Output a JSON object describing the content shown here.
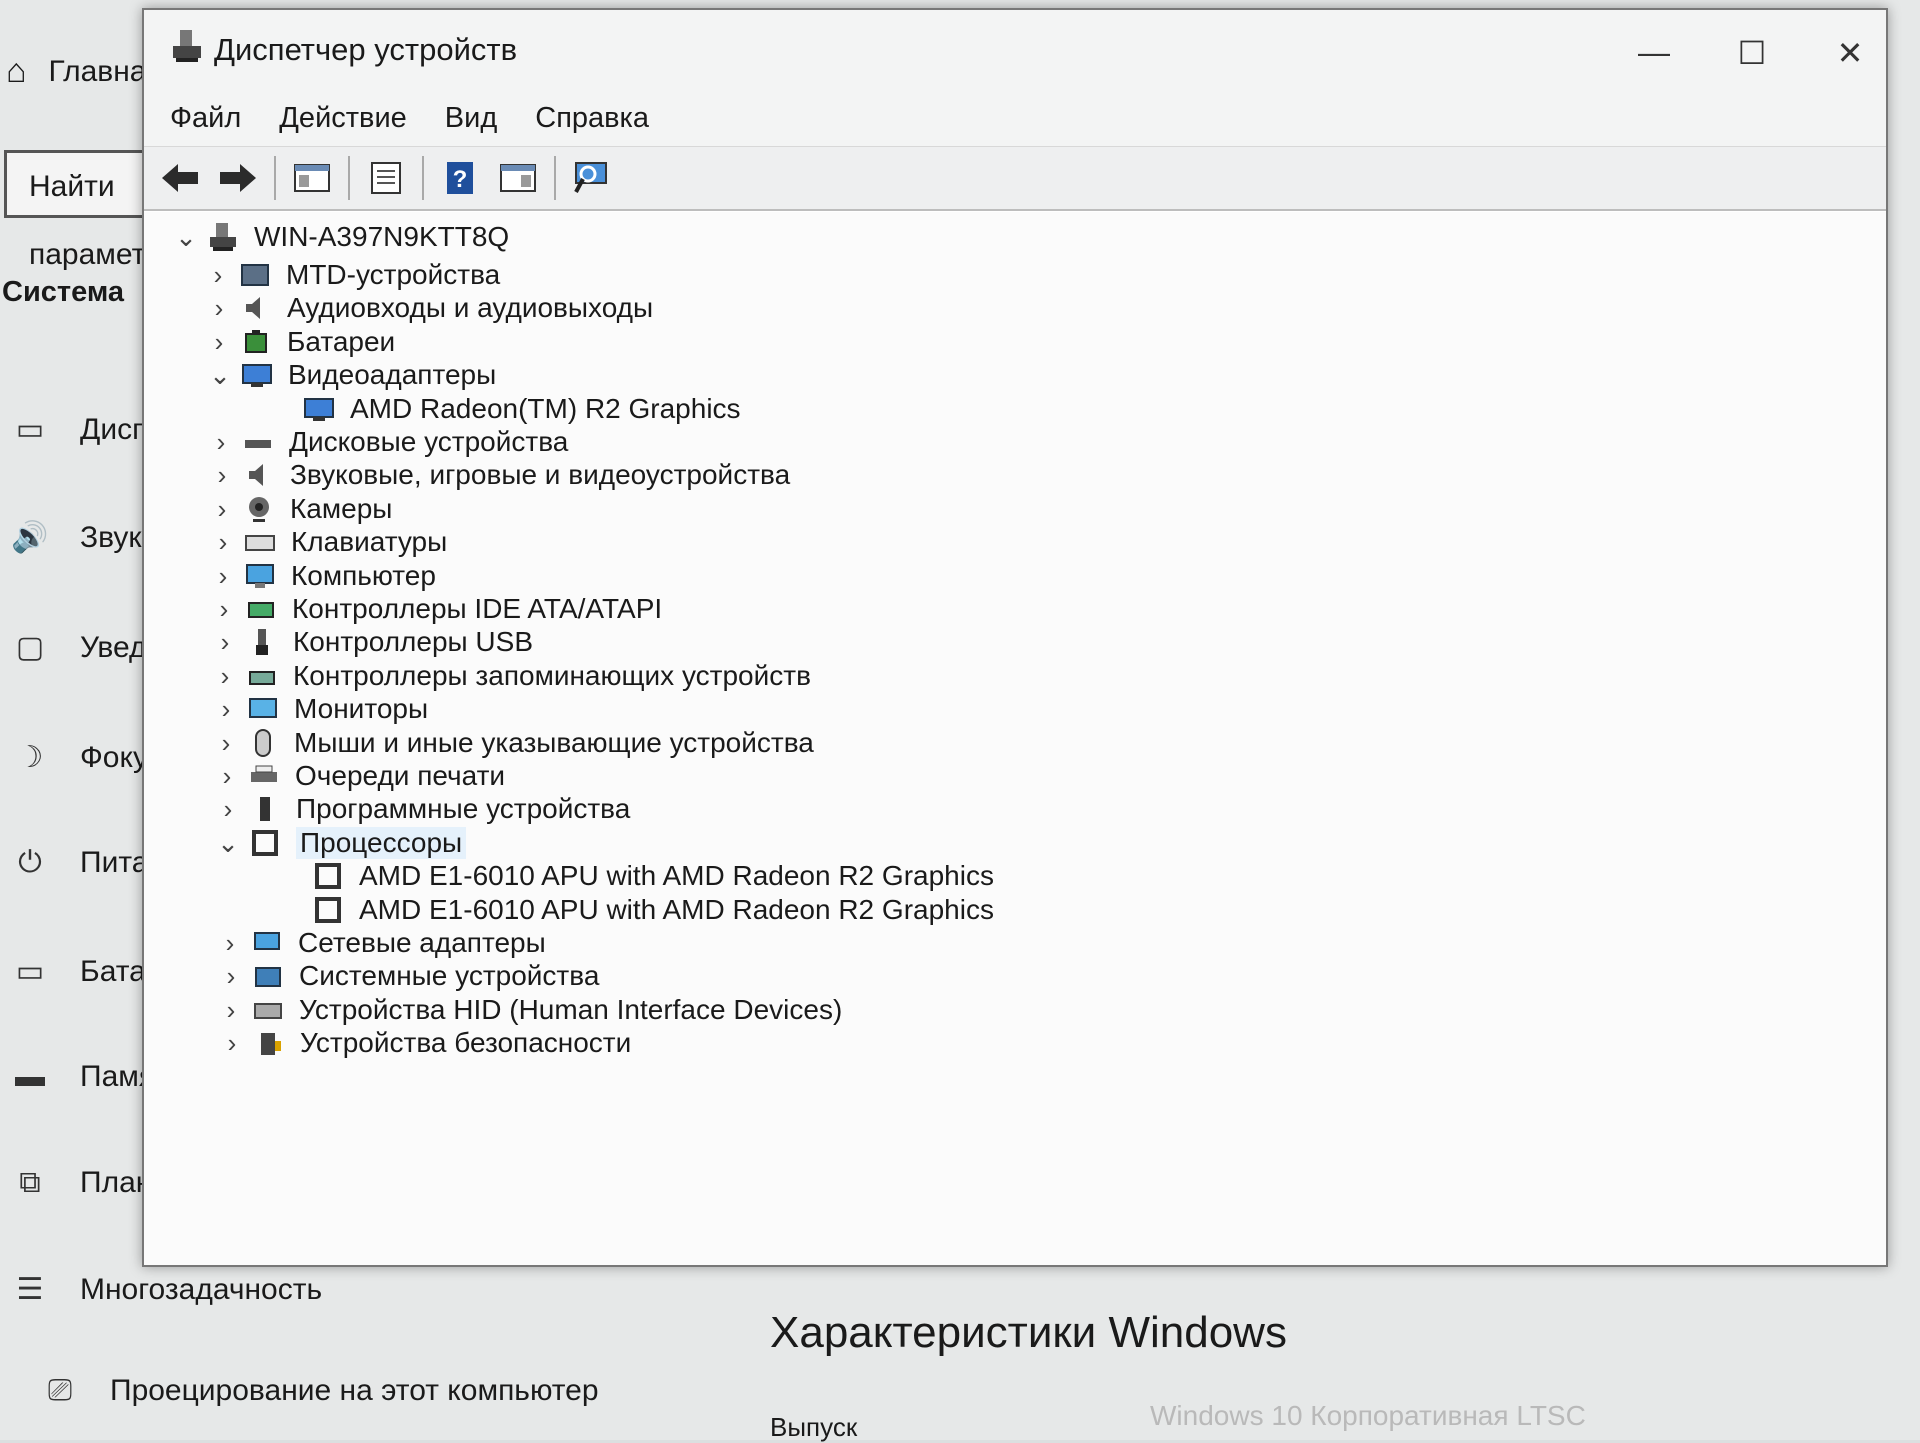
{
  "settings": {
    "home_label": "Главная",
    "search_placeholder": "Найти параметр",
    "section": "Система",
    "nav": [
      {
        "label": "Дисплей",
        "icon": "display-icon"
      },
      {
        "label": "Звук",
        "icon": "sound-icon"
      },
      {
        "label": "Уведомления и действия",
        "icon": "notifications-icon"
      },
      {
        "label": "Фокусировка внимания",
        "icon": "focus-assist-icon"
      },
      {
        "label": "Питание и спящий режим",
        "icon": "power-icon"
      },
      {
        "label": "Батарея",
        "icon": "battery-icon"
      },
      {
        "label": "Память",
        "icon": "storage-icon"
      },
      {
        "label": "Планшет",
        "icon": "tablet-icon"
      },
      {
        "label": "Многозадачность",
        "icon": "multitasking-icon"
      },
      {
        "label": "Проецирование на этот компьютер",
        "icon": "projecting-icon"
      }
    ],
    "windows_spec_heading": "Характеристики Windows",
    "release_label": "Выпуск",
    "release_value": "Windows 10 Корпоративная LTSC"
  },
  "device_manager": {
    "title": "Диспетчер устройств",
    "menu": [
      "Файл",
      "Действие",
      "Вид",
      "Справка"
    ],
    "toolbar": [
      "back-icon",
      "forward-icon",
      "properties-pane-icon",
      "device-properties-icon",
      "help-icon",
      "view-icon",
      "scan-hardware-icon"
    ],
    "root": "WIN-A397N9KTT8Q",
    "tree": [
      {
        "label": "MTD-устройства",
        "icon": "mtd-device-icon",
        "expanded": false,
        "level": 1
      },
      {
        "label": "Аудиовходы и аудиовыходы",
        "icon": "audio-io-icon",
        "expanded": false,
        "level": 1
      },
      {
        "label": "Батареи",
        "icon": "battery-icon",
        "expanded": false,
        "level": 1
      },
      {
        "label": "Видеоадаптеры",
        "icon": "display-adapter-icon",
        "expanded": true,
        "level": 1
      },
      {
        "label": "AMD Radeon(TM) R2 Graphics",
        "icon": "display-adapter-icon",
        "level": 2
      },
      {
        "label": "Дисковые устройства",
        "icon": "disk-drive-icon",
        "expanded": false,
        "level": 1
      },
      {
        "label": "Звуковые, игровые и видеоустройства",
        "icon": "sound-device-icon",
        "expanded": false,
        "level": 1
      },
      {
        "label": "Камеры",
        "icon": "camera-icon",
        "expanded": false,
        "level": 1
      },
      {
        "label": "Клавиатуры",
        "icon": "keyboard-icon",
        "expanded": false,
        "level": 1
      },
      {
        "label": "Компьютер",
        "icon": "computer-icon",
        "expanded": false,
        "level": 1
      },
      {
        "label": "Контроллеры IDE ATA/ATAPI",
        "icon": "ide-controller-icon",
        "expanded": false,
        "level": 1
      },
      {
        "label": "Контроллеры USB",
        "icon": "usb-icon",
        "expanded": false,
        "level": 1
      },
      {
        "label": "Контроллеры запоминающих устройств",
        "icon": "storage-controller-icon",
        "expanded": false,
        "level": 1
      },
      {
        "label": "Мониторы",
        "icon": "monitor-icon",
        "expanded": false,
        "level": 1
      },
      {
        "label": "Мыши и иные указывающие устройства",
        "icon": "mouse-icon",
        "expanded": false,
        "level": 1
      },
      {
        "label": "Очереди печати",
        "icon": "print-queue-icon",
        "expanded": false,
        "level": 1
      },
      {
        "label": "Программные устройства",
        "icon": "software-device-icon",
        "expanded": false,
        "level": 1
      },
      {
        "label": "Процессоры",
        "icon": "processor-icon",
        "expanded": true,
        "selected": true,
        "level": 1
      },
      {
        "label": "AMD E1-6010 APU with AMD Radeon R2 Graphics",
        "icon": "processor-icon",
        "level": 2
      },
      {
        "label": "AMD E1-6010 APU with AMD Radeon R2 Graphics",
        "icon": "processor-icon",
        "level": 2
      },
      {
        "label": "Сетевые адаптеры",
        "icon": "network-adapter-icon",
        "expanded": false,
        "level": 1
      },
      {
        "label": "Системные устройства",
        "icon": "system-device-icon",
        "expanded": false,
        "level": 1
      },
      {
        "label": "Устройства HID (Human Interface Devices)",
        "icon": "hid-icon",
        "expanded": false,
        "level": 1
      },
      {
        "label": "Устройства безопасности",
        "icon": "security-device-icon",
        "expanded": false,
        "level": 1
      }
    ]
  }
}
